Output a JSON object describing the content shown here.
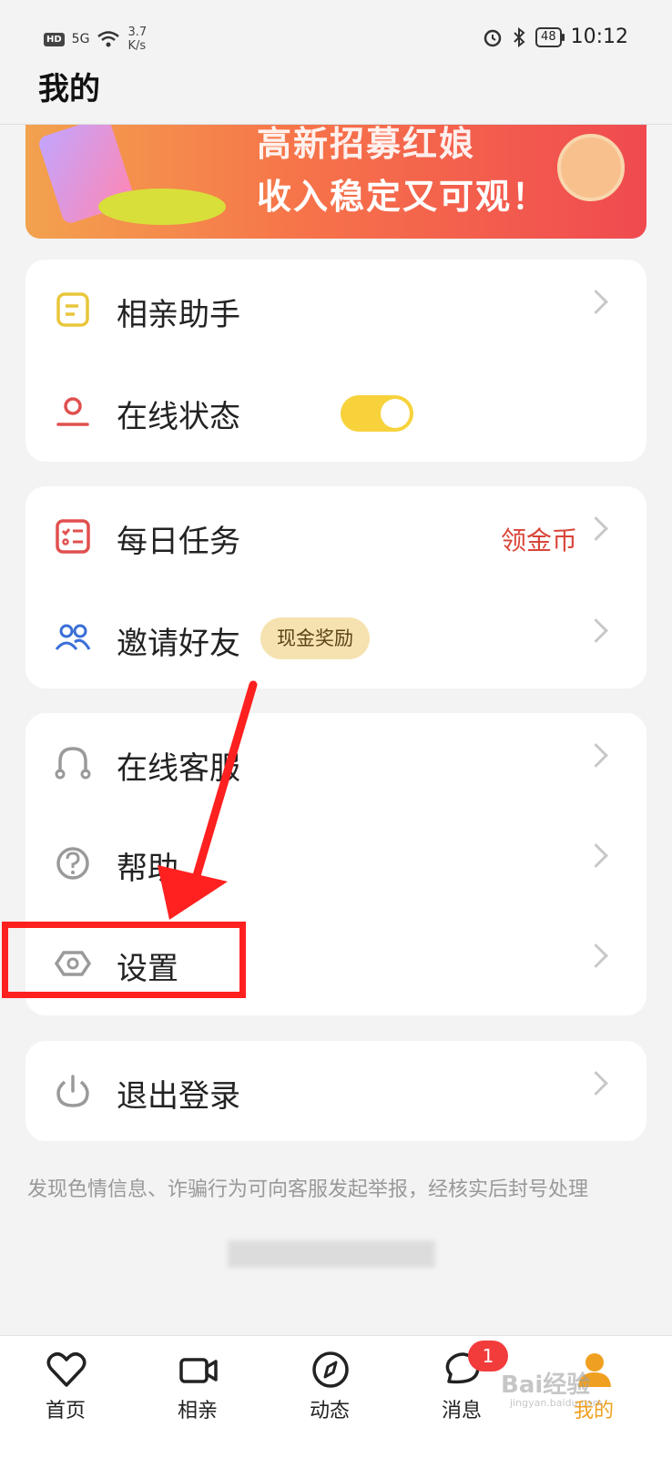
{
  "status_bar": {
    "badge_hd": "HD",
    "network": "5G",
    "speed_value": "3.7",
    "speed_unit": "K/s",
    "battery": "48",
    "time": "10:12"
  },
  "header": {
    "title": "我的"
  },
  "banner": {
    "line1": "高新招募红娘",
    "line2": "收入稳定又可观！"
  },
  "groups": {
    "g1": {
      "items": [
        {
          "label": "相亲助手"
        },
        {
          "label": "在线状态",
          "toggle_on": true
        }
      ]
    },
    "g2": {
      "items": [
        {
          "label": "每日任务",
          "extra": "领金币"
        },
        {
          "label": "邀请好友",
          "badge": "现金奖励"
        }
      ]
    },
    "g3": {
      "items": [
        {
          "label": "在线客服"
        },
        {
          "label": "帮助"
        },
        {
          "label": "设置"
        }
      ]
    },
    "g4": {
      "items": [
        {
          "label": "退出登录"
        }
      ]
    }
  },
  "notice": "发现色情信息、诈骗行为可向客服发起举报，经核实后封号处理",
  "colors": {
    "accent": "#f7d23b",
    "highlight": "#ff2020",
    "active_tab": "#f0a020",
    "badge": "#f23b3b"
  },
  "tabs": [
    {
      "label": "首页",
      "icon": "heart-icon"
    },
    {
      "label": "相亲",
      "icon": "video-camera-icon"
    },
    {
      "label": "动态",
      "icon": "compass-icon"
    },
    {
      "label": "消息",
      "icon": "chat-icon",
      "badge": "1"
    },
    {
      "label": "我的",
      "icon": "person-icon",
      "active": true
    }
  ],
  "watermark": {
    "text": "Bai经验",
    "sub": "jingyan.baidu.com"
  }
}
